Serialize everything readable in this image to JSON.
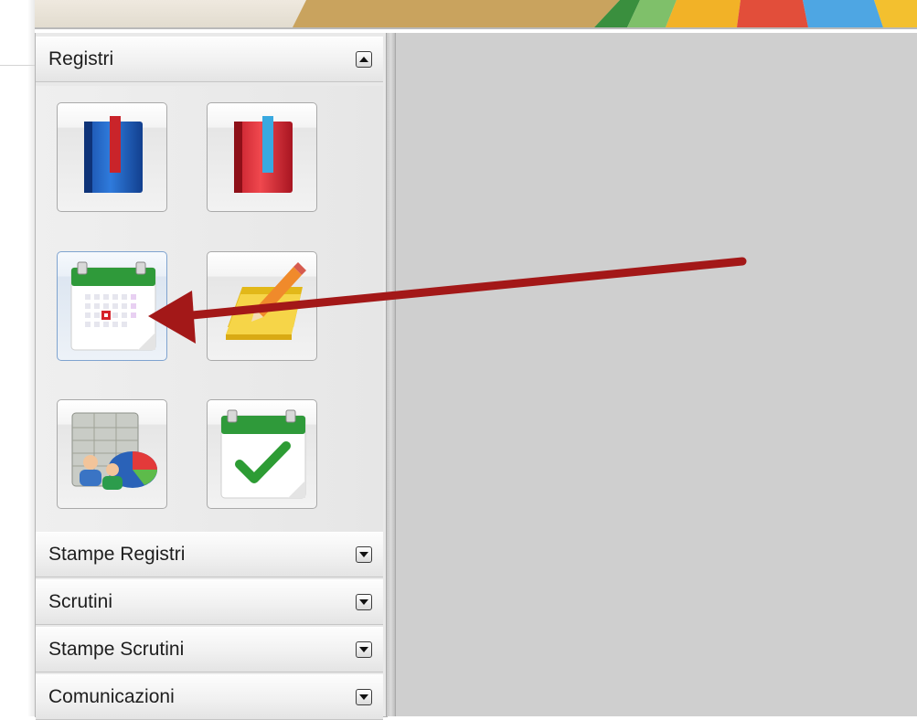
{
  "sidebar": {
    "sections": [
      {
        "label": "Registri",
        "expanded": true
      },
      {
        "label": "Stampe Registri",
        "expanded": false
      },
      {
        "label": "Scrutini",
        "expanded": false
      },
      {
        "label": "Stampe Scrutini",
        "expanded": false
      },
      {
        "label": "Comunicazioni",
        "expanded": false
      }
    ],
    "registri_icons": [
      {
        "icon": "blue-register-book-icon"
      },
      {
        "icon": "red-register-book-icon"
      },
      {
        "icon": "calendar-day-icon",
        "selected": true
      },
      {
        "icon": "notepad-pencil-icon"
      },
      {
        "icon": "spreadsheet-users-chart-icon"
      },
      {
        "icon": "calendar-checkmark-icon"
      }
    ]
  },
  "annotation": {
    "type": "arrow",
    "color": "#a31818"
  },
  "colors": {
    "content_background": "#cfcfcf",
    "panel_background": "#e9e9e9",
    "selected_border": "#7fa3cf"
  }
}
